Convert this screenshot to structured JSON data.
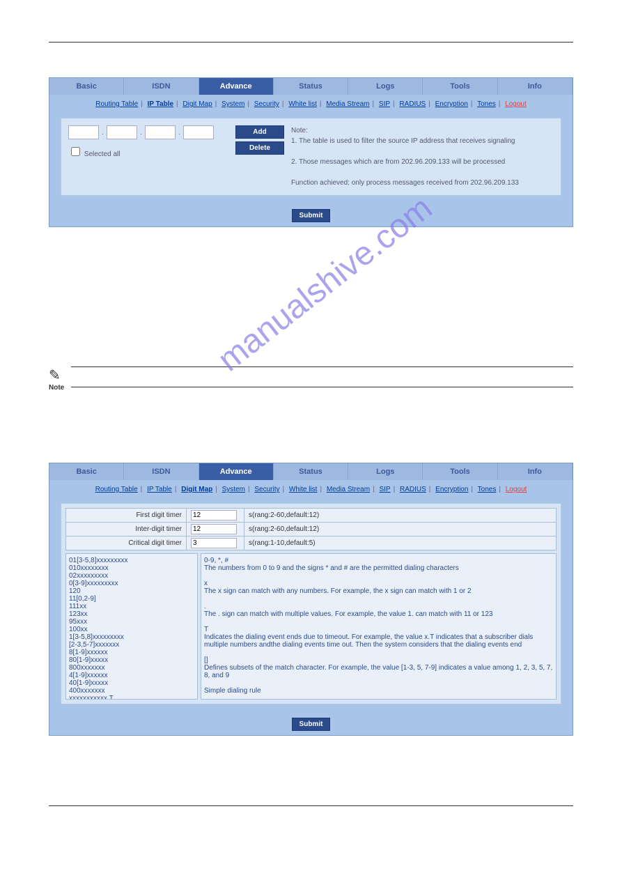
{
  "tabs": [
    "Basic",
    "ISDN",
    "Advance",
    "Status",
    "Logs",
    "Tools",
    "Info"
  ],
  "active_tab": "Advance",
  "subnav": [
    "Routing Table",
    "IP Table",
    "Digit Map",
    "System",
    "Security",
    "White list",
    "Media Stream",
    "SIP",
    "RADIUS",
    "Encryption",
    "Tones",
    "Logout"
  ],
  "panel1": {
    "active_sub": "IP Table",
    "selected_all": "Selected all",
    "add": "Add",
    "delete": "Delete",
    "note_title": "Note:",
    "note1": "1. The table is used to filter the source IP address that receives signaling",
    "note2": "2. Those messages which are from 202.96.209.133 will be processed",
    "note3": "Function achieved: only process messages received from 202.96.209.133",
    "submit": "Submit"
  },
  "note_label": "Note",
  "watermark": "manualshive.com",
  "panel2": {
    "active_sub": "Digit Map",
    "first_label": "First digit timer",
    "first_val": "12",
    "first_hint": "s(rang:2-60,default:12)",
    "inter_label": "Inter-digit timer",
    "inter_val": "12",
    "inter_hint": "s(rang:2-60,default:12)",
    "crit_label": "Critical digit timer",
    "crit_val": "3",
    "crit_hint": "s(rang:1-10,default:5)",
    "left_text": "01[3-5,8]xxxxxxxxx\n010xxxxxxxx\n02xxxxxxxxx\n0[3-9]xxxxxxxxx\n120\n11[0,2-9]\n111xx\n123xx\n95xxx\n100xx\n1[3-5,8]xxxxxxxxx\n[2-3,5-7]xxxxxxx\n8[1-9]xxxxxx\n80[1-9]xxxxx\n800xxxxxxx\n4[1-9]xxxxxx\n40[1-9]xxxxx\n400xxxxxxx\nxxxxxxxxxxx.T\nx.#\n#xx",
    "right_text": "0-9, *, #\nThe numbers from 0 to 9 and the signs * and # are the permitted dialing characters\n\nx\nThe x sign can match with any numbers. For example, the x sign can match with 1 or 2\n\n.\nThe . sign can match with multiple values. For example, the value 1. can match with 11 or 123\n\nT\nIndicates the dialing event ends due to timeout. For example, the value x.T indicates that a subscriber dials multiple numbers andthe dialing events time out. Then the system considers that the dialing events end\n\n[]\nDefines subsets of the match character. For example, the value [1-3, 5, 7-9] indicates a value among 1, 2, 3, 5, 7, 8, and 9\n\nSimple dialing rule",
    "submit": "Submit"
  }
}
